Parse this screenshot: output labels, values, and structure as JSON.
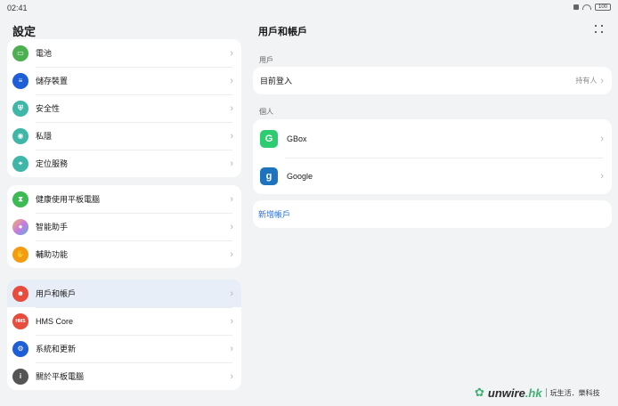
{
  "status_bar": {
    "time": "02:41",
    "battery": "100"
  },
  "left": {
    "title": "設定",
    "groups": [
      [
        {
          "label": "電池",
          "icon": "battery-icon",
          "color": "#4caf50"
        },
        {
          "label": "儲存裝置",
          "icon": "storage-icon",
          "color": "#1e5ed6"
        },
        {
          "label": "安全性",
          "icon": "shield-icon",
          "color": "#3fb6a8"
        },
        {
          "label": "私隱",
          "icon": "privacy-icon",
          "color": "#3fb6a8"
        },
        {
          "label": "定位服務",
          "icon": "location-icon",
          "color": "#3fb6a8"
        }
      ],
      [
        {
          "label": "健康使用平板電腦",
          "icon": "hourglass-icon",
          "color": "#3cba54"
        },
        {
          "label": "智能助手",
          "icon": "assistant-icon",
          "color": "#c77ddc"
        },
        {
          "label": "輔助功能",
          "icon": "hand-icon",
          "color": "#f39c12"
        }
      ],
      [
        {
          "label": "用戶和帳戶",
          "icon": "user-icon",
          "color": "#e74c3c"
        },
        {
          "label": "HMS Core",
          "icon": "hms-icon",
          "color": "#e74c3c",
          "text": "HMS"
        },
        {
          "label": "系統和更新",
          "icon": "gear-icon",
          "color": "#1e5ed6"
        },
        {
          "label": "關於平板電腦",
          "icon": "info-icon",
          "color": "#555555"
        }
      ]
    ]
  },
  "right": {
    "title": "用戶和帳戶",
    "section_user": "用戶",
    "current_login": {
      "label": "目前登入",
      "value": "持有人"
    },
    "section_personal": "個人",
    "accounts": [
      {
        "label": "GBox",
        "icon": "gbox-icon",
        "color": "#2ecc71",
        "glyph": "G"
      },
      {
        "label": "Google",
        "icon": "google-icon",
        "color": "#1e73be",
        "glyph": "g"
      }
    ],
    "add_account": "新增帳戶"
  },
  "watermark": {
    "brand": "unwire",
    "suffix": ".hk",
    "slogan": "玩生活．樂科技"
  }
}
